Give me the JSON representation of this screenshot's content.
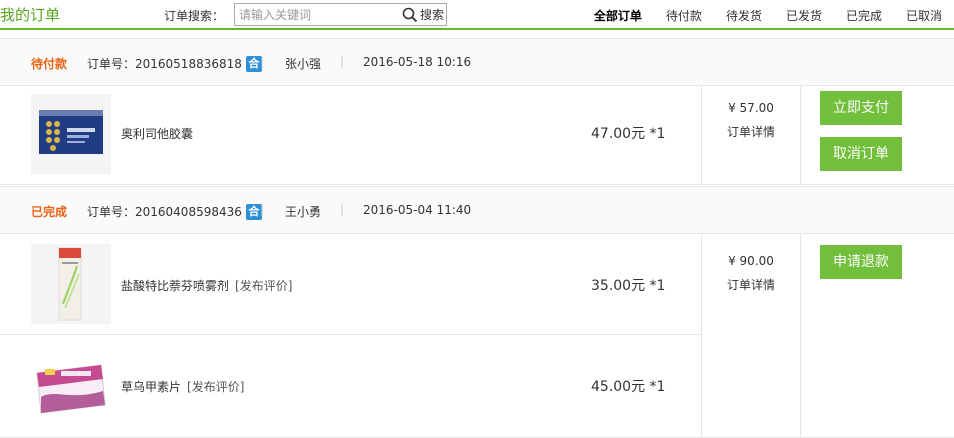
{
  "header": {
    "title": "我的订单",
    "search_label": "订单搜索：",
    "search_placeholder": "请输入关键词",
    "search_button": "搜索"
  },
  "tabs": [
    {
      "label": "全部订单",
      "active": true
    },
    {
      "label": "待付款",
      "active": false
    },
    {
      "label": "待发货",
      "active": false
    },
    {
      "label": "已发货",
      "active": false
    },
    {
      "label": "已完成",
      "active": false
    },
    {
      "label": "已取消",
      "active": false
    }
  ],
  "orders": [
    {
      "status": "待付款",
      "order_no": "订单号：20160518836818",
      "badge": "合",
      "buyer": "张小强",
      "time": "2016-05-18 10:16",
      "total": "¥ 57.00",
      "detail": "订单详情",
      "actions": [
        "立即支付",
        "取消订单"
      ],
      "items": [
        {
          "name": "奥利司他胶囊",
          "review": "",
          "price": "47.00元 *1"
        }
      ]
    },
    {
      "status": "已完成",
      "order_no": "订单号：20160408598436",
      "badge": "合",
      "buyer": "王小勇",
      "time": "2016-05-04 11:40",
      "total": "¥ 90.00",
      "detail": "订单详情",
      "actions": [
        "申请退款"
      ],
      "items": [
        {
          "name": "盐酸特比萘芬喷雾剂",
          "review": "[发布评价]",
          "price": "35.00元 *1"
        },
        {
          "name": "草乌甲素片",
          "review": "[发布评价]",
          "price": "45.00元 *1"
        }
      ]
    }
  ],
  "colors": {
    "accent": "#6cb52d",
    "status": "#e86414",
    "button": "#71bf3b",
    "badge": "#2e8fd6"
  }
}
